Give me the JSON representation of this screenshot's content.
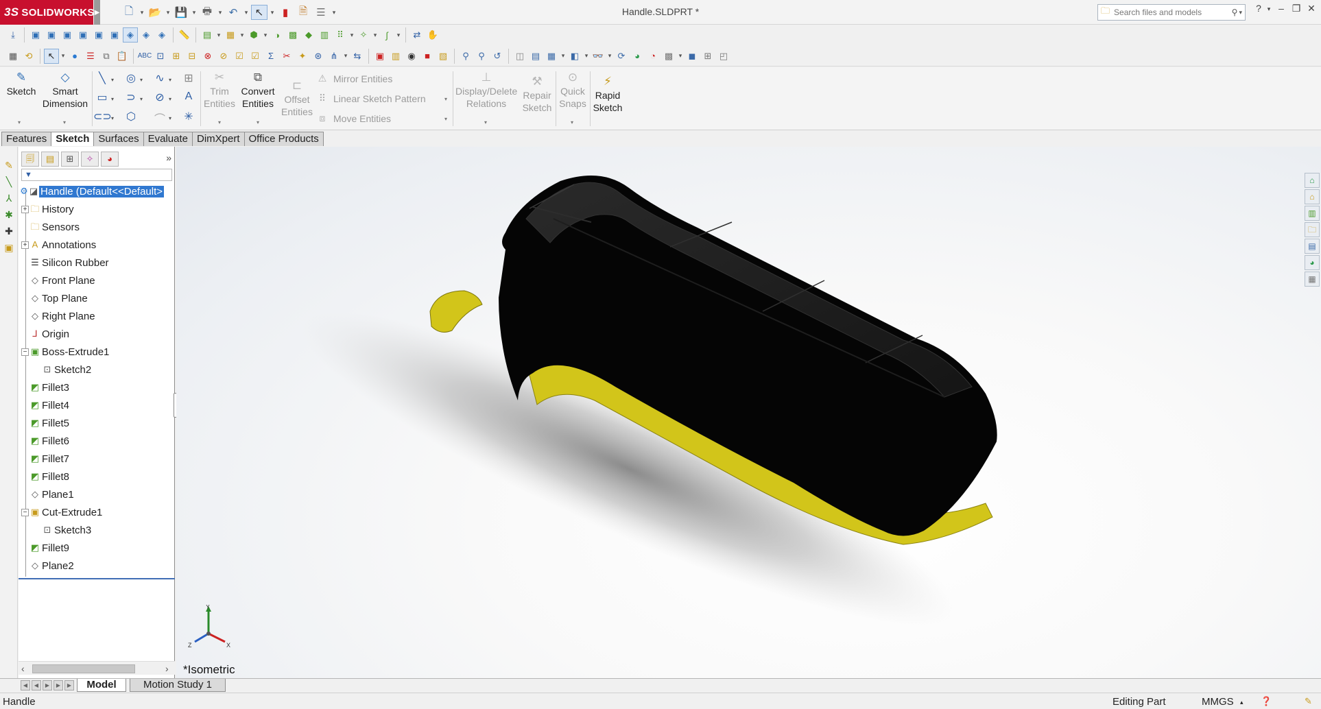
{
  "app": {
    "brand": "SOLIDWORKS",
    "document_title": "Handle.SLDPRT *"
  },
  "search": {
    "placeholder": "Search files and models"
  },
  "ribbon": {
    "sketch": "Sketch",
    "smart_dimension": [
      "Smart",
      "Dimension"
    ],
    "trim_entities": [
      "Trim",
      "Entities"
    ],
    "convert_entities": [
      "Convert",
      "Entities"
    ],
    "offset_entities": [
      "Offset",
      "Entities"
    ],
    "mirror_entities": "Mirror Entities",
    "linear_sketch_pattern": "Linear Sketch Pattern",
    "move_entities": "Move Entities",
    "display_delete_relations": [
      "Display/Delete",
      "Relations"
    ],
    "repair_sketch": [
      "Repair",
      "Sketch"
    ],
    "quick_snaps": [
      "Quick",
      "Snaps"
    ],
    "rapid_sketch": [
      "Rapid",
      "Sketch"
    ]
  },
  "command_tabs": [
    "Features",
    "Sketch",
    "Surfaces",
    "Evaluate",
    "DimXpert",
    "Office Products"
  ],
  "active_command_tab": "Sketch",
  "feature_tree": {
    "root": "Handle  (Default<<Default>",
    "items": [
      "History",
      "Sensors",
      "Annotations",
      "Silicon Rubber",
      "Front Plane",
      "Top Plane",
      "Right Plane",
      "Origin",
      "Boss-Extrude1",
      "Sketch2",
      "Fillet3",
      "Fillet4",
      "Fillet5",
      "Fillet6",
      "Fillet7",
      "Fillet8",
      "Plane1",
      "Cut-Extrude1",
      "Sketch3",
      "Fillet9",
      "Plane2"
    ]
  },
  "viewport": {
    "view_name": "*Isometric",
    "triad_labels": [
      "Y",
      "X",
      "Z"
    ],
    "model_colors": {
      "body": "#050505",
      "rubber": "#d2c51a"
    }
  },
  "bottom_tabs": [
    "Model",
    "Motion Study 1"
  ],
  "status": {
    "document": "Handle",
    "mode": "Editing Part",
    "units": "MMGS"
  },
  "icons": [
    "solidworks-logo",
    "new-icon",
    "open-icon",
    "save-icon",
    "print-icon",
    "undo-icon",
    "select-icon",
    "rebuild-icon",
    "options-icon",
    "search-icon",
    "help-icon"
  ]
}
